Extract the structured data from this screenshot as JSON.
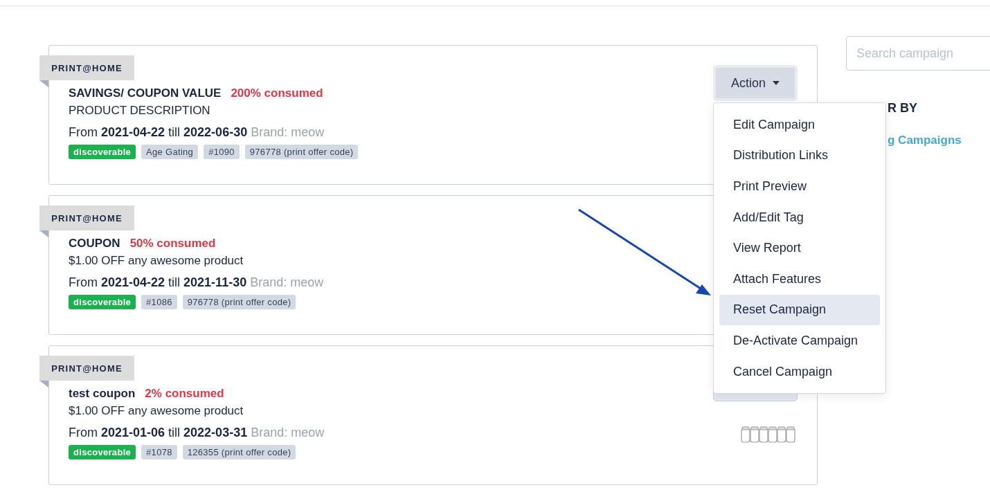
{
  "campaigns": [
    {
      "channel": "PRINT@HOME",
      "title": "SAVINGS/ COUPON VALUE",
      "consumed": "200% consumed",
      "description": "PRODUCT DESCRIPTION",
      "from_label": "From",
      "start": "2021-04-22",
      "till_label": "till",
      "end": "2022-06-30",
      "brand": "Brand: meow",
      "tags": [
        {
          "label": "discoverable",
          "kind": "status"
        },
        {
          "label": "Age Gating",
          "kind": "tag"
        },
        {
          "label": "#1090",
          "kind": "tag"
        },
        {
          "label": "976778 (print offer code)",
          "kind": "tag"
        }
      ],
      "action_button": {
        "label": "Action",
        "open": true
      }
    },
    {
      "channel": "PRINT@HOME",
      "title": "COUPON",
      "consumed": "50% consumed",
      "description": "$1.00 OFF any awesome product",
      "from_label": "From",
      "start": "2021-04-22",
      "till_label": "till",
      "end": "2021-11-30",
      "brand": "Brand: meow",
      "tags": [
        {
          "label": "discoverable",
          "kind": "status"
        },
        {
          "label": "#1086",
          "kind": "tag"
        },
        {
          "label": "976778 (print offer code)",
          "kind": "tag"
        }
      ]
    },
    {
      "channel": "PRINT@HOME",
      "title": "test coupon",
      "consumed": "2% consumed",
      "description": "$1.00 OFF any awesome product",
      "from_label": "From",
      "start": "2021-01-06",
      "till_label": "till",
      "end": "2022-03-31",
      "brand": "Brand: meow",
      "tags": [
        {
          "label": "discoverable",
          "kind": "status"
        },
        {
          "label": "#1078",
          "kind": "tag"
        },
        {
          "label": "126355 (print offer code)",
          "kind": "tag"
        }
      ],
      "action_button": {
        "open": false
      },
      "coupon_icons": true
    }
  ],
  "action_menu": {
    "items": [
      {
        "label": "Edit Campaign",
        "selected": false
      },
      {
        "label": "Distribution Links",
        "selected": false
      },
      {
        "label": "Print Preview",
        "selected": false
      },
      {
        "label": "Add/Edit Tag",
        "selected": false
      },
      {
        "label": "View Report",
        "selected": false
      },
      {
        "label": "Attach Features",
        "selected": false
      },
      {
        "label": "Reset Campaign",
        "selected": true
      },
      {
        "label": "De-Activate Campaign",
        "selected": false
      },
      {
        "label": "Cancel Campaign",
        "selected": false
      }
    ]
  },
  "sidebar": {
    "search": {
      "placeholder": "Search campaign"
    },
    "filter_heading": "R BY",
    "filter_link": "g Campaigns"
  },
  "annotation_arrow": true
}
